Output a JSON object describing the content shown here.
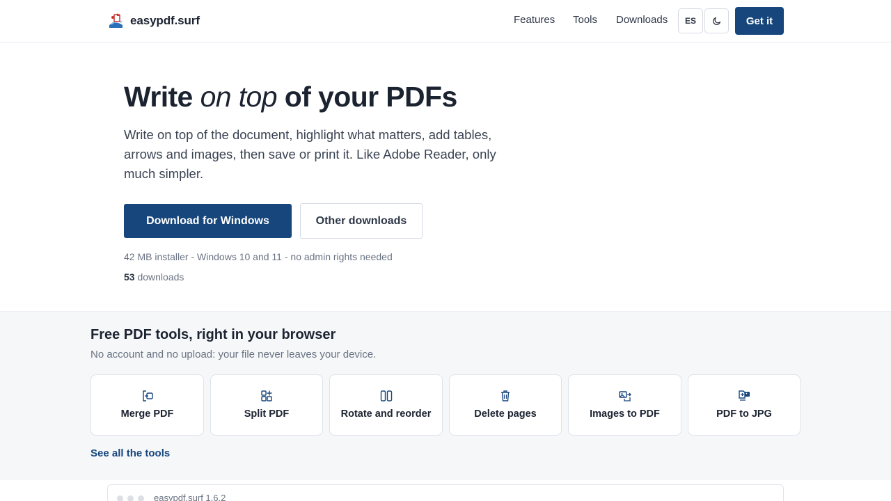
{
  "header": {
    "brand": "easypdf.surf",
    "nav": [
      "Features",
      "Tools",
      "Downloads"
    ],
    "lang_button": "ES",
    "cta": "Get it"
  },
  "hero": {
    "title_before": "Write ",
    "title_emphasis": "on top",
    "title_after": " of your PDFs",
    "subtitle": "Write on top of the document, highlight what matters, add tables, arrows and images, then save or print it. Like Adobe Reader, only much simpler.",
    "primary_button": "Download for Windows",
    "secondary_button": "Other downloads",
    "meta": "42 MB installer - Windows 10 and 11 - no admin rights needed",
    "downloads_count": "53",
    "downloads_label": " downloads"
  },
  "tools": {
    "title": "Free PDF tools, right in your browser",
    "subtitle": "No account and no upload: your file never leaves your device.",
    "items": [
      {
        "label": "Merge PDF",
        "icon": "merge-icon"
      },
      {
        "label": "Split PDF",
        "icon": "split-icon"
      },
      {
        "label": "Rotate and reorder",
        "icon": "rotate-reorder-icon"
      },
      {
        "label": "Delete pages",
        "icon": "trash-icon"
      },
      {
        "label": "Images to PDF",
        "icon": "images-to-pdf-icon"
      },
      {
        "label": "PDF to JPG",
        "icon": "pdf-to-jpg-icon"
      }
    ],
    "see_all": "See all the tools"
  },
  "preview": {
    "title": "easypdf.surf 1.6.2"
  },
  "colors": {
    "primary": "#17467c",
    "text": "#1b2230",
    "muted": "#6a7382",
    "section_bg": "#f5f7f9"
  }
}
